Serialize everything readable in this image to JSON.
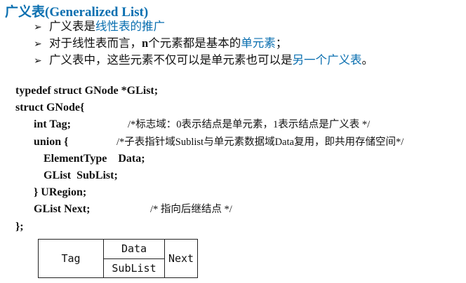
{
  "title": "广义表(Generalized List)",
  "bullets": [
    {
      "arrow": "➢",
      "pre": "广义表是",
      "em": "线性表的推广",
      "post": ""
    },
    {
      "arrow": "➢",
      "pre": "对于线性表而言，",
      "bold": "n",
      "mid": "个元素都是基本的",
      "em": "单元素",
      "post": "；"
    },
    {
      "arrow": "➢",
      "pre": "广义表中，这些元素不仅可以是单元素也可以是",
      "em": "另一个广义表",
      "post": "。"
    }
  ],
  "code": [
    {
      "text": "typedef struct GNode *GList;",
      "comment": ""
    },
    {
      "text": "struct GNode{",
      "comment": ""
    },
    {
      "text": "int Tag;",
      "comment": "/*标志域：0表示结点是单元素，1表示结点是广义表 */"
    },
    {
      "text": "union {",
      "comment": "/*子表指针域Sublist与单元素数据域Data复用，即共用存储空间*/"
    },
    {
      "text": "ElementType    Data;",
      "comment": ""
    },
    {
      "text": "GList  SubList;",
      "comment": ""
    },
    {
      "text": "} URegion;",
      "comment": ""
    },
    {
      "text": "GList Next;",
      "comment": "/* 指向后继结点 */"
    },
    {
      "text": "};",
      "comment": ""
    }
  ],
  "diagram": {
    "tag": "Tag",
    "data": "Data",
    "sublist": "SubList",
    "next": "Next"
  }
}
